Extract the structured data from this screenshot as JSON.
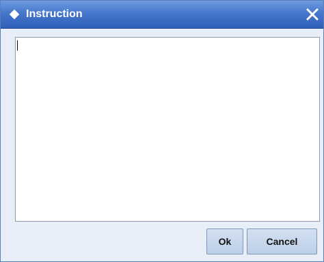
{
  "dialog": {
    "title": "Instruction",
    "title_icon": "diamond-icon",
    "close_icon": "close-icon",
    "instruction_value": ""
  },
  "buttons": {
    "ok_label": "Ok",
    "cancel_label": "Cancel"
  },
  "colors": {
    "titlebar": "#3f6fc4",
    "dialog_background": "#e8eef7",
    "button_background": "#c8d8ee",
    "title_text": "#ffffff"
  }
}
